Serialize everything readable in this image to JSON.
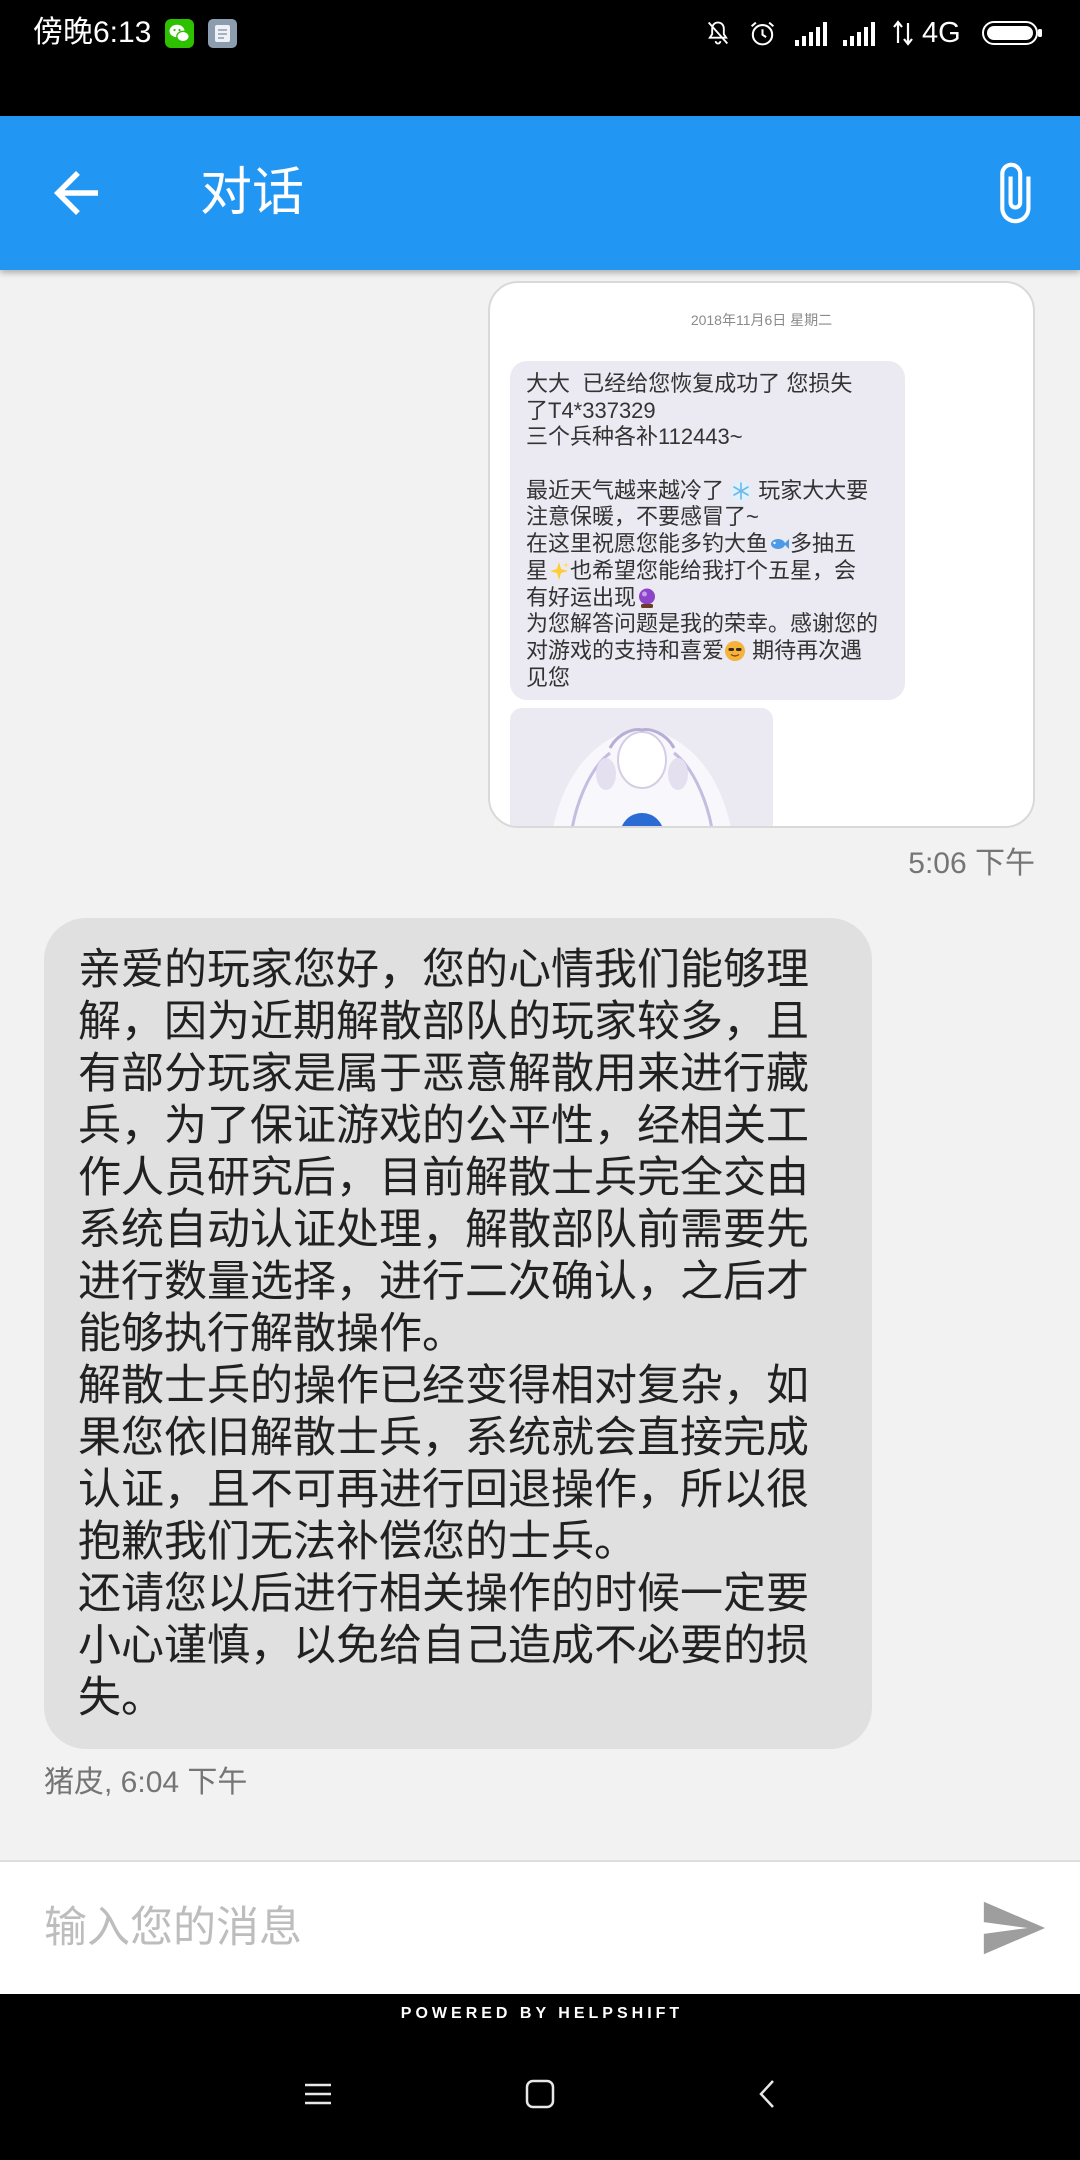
{
  "status_bar": {
    "time": "傍晚6:13",
    "network_type": "4G",
    "left_icons": [
      "wechat-icon",
      "app-icon"
    ],
    "right_icons": [
      "mute-icon",
      "alarm-icon",
      "signal-icon",
      "signal-icon",
      "data-activity-icon",
      "battery-icon"
    ]
  },
  "header": {
    "title": "对话",
    "back_icon": "arrow-left-icon",
    "action_icon": "paperclip-icon",
    "background": "#2196f3"
  },
  "conversation": {
    "messages": [
      {
        "timestamp": "5:06 下午",
        "image": {
          "date": "2018年11月6日 星期二",
          "lines": [
            {
              "text": "大大  已经给您恢复成功了 您损失"
            },
            {
              "text": "了T4*337329"
            },
            {
              "text": "三个兵种各补112443~"
            },
            {
              "before": "最近天气越来越冷了 ",
              "emoji": "snowflake-emoji",
              "after": " 玩家大大要"
            },
            {
              "text": "注意保暖，不要感冒了~"
            },
            {
              "before": "在这里祝愿您能多钓大鱼",
              "emoji": "fish-emoji",
              "after": "多抽五"
            },
            {
              "before": "星",
              "emoji": "sparkles-emoji",
              "after": "也希望您能给我打个五星，会"
            },
            {
              "before": "有好运出现",
              "emoji": "crystal-ball-emoji"
            },
            {
              "text": "为您解答问题是我的荣幸。感谢您的"
            },
            {
              "before": "对游戏的支持和喜爱",
              "emoji": "smiling-face-emoji",
              "after": " 期待再次遇"
            },
            {
              "text": "见您"
            }
          ]
        }
      },
      {
        "paragraphs": [
          "亲爱的玩家您好，您的心情我们能够理解，因为近期解散部队的玩家较多，且有部分玩家是属于恶意解散用来进行藏兵，为了保证游戏的公平性，经相关工作人员研究后，目前解散士兵完全交由系统自动认证处理，解散部队前需要先进行数量选择，进行二次确认，之后才能够执行解散操作。",
          "解散士兵的操作已经变得相对复杂，如果您依旧解散士兵，系统就会直接完成认证，且不可再进行回退操作，所以很抱歉我们无法补偿您的士兵。",
          "还请您以后进行相关操作的时候一定要小心谨慎，以免给自己造成不必要的损失。"
        ],
        "meta": "猪皮, 6:04 下午"
      }
    ]
  },
  "composer": {
    "placeholder": "输入您的消息",
    "send_icon": "send-icon"
  },
  "footer": {
    "powered_by": "POWERED BY HELPSHIFT"
  },
  "nav_bar": {
    "icons": [
      "menu-icon",
      "home-icon",
      "back-icon"
    ]
  }
}
